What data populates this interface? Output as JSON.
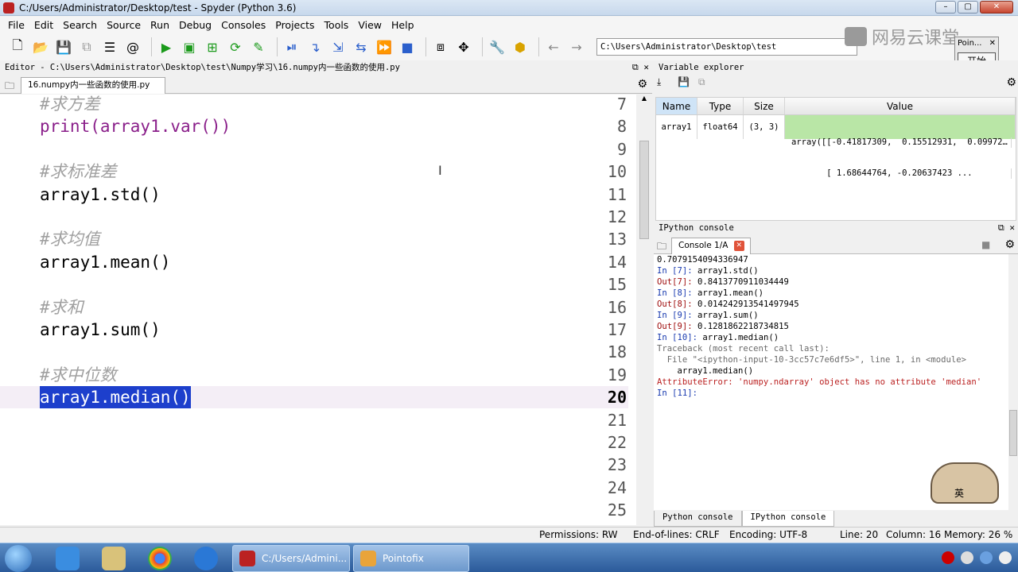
{
  "window": {
    "title": "C:/Users/Administrator/Desktop/test - Spyder (Python 3.6)",
    "controls": [
      "–",
      "▢",
      "✕"
    ]
  },
  "menu": [
    "File",
    "Edit",
    "Search",
    "Source",
    "Run",
    "Debug",
    "Consoles",
    "Projects",
    "Tools",
    "View",
    "Help"
  ],
  "toolbar": {
    "path": "C:\\Users\\Administrator\\Desktop\\test"
  },
  "watermark": "网易云课堂",
  "pointofix": {
    "title": "Poin...",
    "button": "开始"
  },
  "editor": {
    "pane_title": "Editor - C:\\Users\\Administrator\\Desktop\\test\\Numpy学习\\16.numpy内一些函数的使用.py",
    "tab": "16.numpy内一些函数的使用.py",
    "lines": [
      {
        "n": "7",
        "text": "#求方差",
        "kind": "comment"
      },
      {
        "n": "8",
        "text": "print(array1.var())",
        "kind": "print"
      },
      {
        "n": "9",
        "text": "",
        "kind": "code"
      },
      {
        "n": "10",
        "text": "#求标准差",
        "kind": "comment"
      },
      {
        "n": "11",
        "text": "array1.std()",
        "kind": "code"
      },
      {
        "n": "12",
        "text": "",
        "kind": "code"
      },
      {
        "n": "13",
        "text": "#求均值",
        "kind": "comment"
      },
      {
        "n": "14",
        "text": "array1.mean()",
        "kind": "code"
      },
      {
        "n": "15",
        "text": "",
        "kind": "code"
      },
      {
        "n": "16",
        "text": "#求和",
        "kind": "comment"
      },
      {
        "n": "17",
        "text": "array1.sum()",
        "kind": "code"
      },
      {
        "n": "18",
        "text": "",
        "kind": "code"
      },
      {
        "n": "19",
        "text": "#求中位数",
        "kind": "comment"
      },
      {
        "n": "20",
        "text": "array1.median()",
        "kind": "selected"
      },
      {
        "n": "21",
        "text": "",
        "kind": "code"
      },
      {
        "n": "22",
        "text": "",
        "kind": "code"
      },
      {
        "n": "23",
        "text": "",
        "kind": "code"
      },
      {
        "n": "24",
        "text": "",
        "kind": "code"
      },
      {
        "n": "25",
        "text": "",
        "kind": "code"
      }
    ]
  },
  "variable_explorer": {
    "title": "Variable explorer",
    "headers": {
      "name": "Name",
      "type": "Type",
      "size": "Size",
      "value": "Value"
    },
    "rows": [
      {
        "name": "array1",
        "type": "float64",
        "size": "(3, 3)",
        "value_line1": "array([[-0.41817309,  0.15512931,  0.09972…",
        "value_line2": "       [ 1.68644764, -0.20637423 ..."
      }
    ]
  },
  "ipython": {
    "title": "IPython console",
    "tab": "Console 1/A",
    "lines": [
      {
        "text": "0.7079154094336947",
        "cls": ""
      },
      {
        "text": "",
        "cls": ""
      },
      {
        "text": "In [7]: array1.std()",
        "cls": "in"
      },
      {
        "text": "Out[7]: 0.8413770911034449",
        "cls": "out"
      },
      {
        "text": "",
        "cls": ""
      },
      {
        "text": "In [8]: array1.mean()",
        "cls": "in"
      },
      {
        "text": "Out[8]: 0.014242913541497945",
        "cls": "out"
      },
      {
        "text": "",
        "cls": ""
      },
      {
        "text": "In [9]: array1.sum()",
        "cls": "in"
      },
      {
        "text": "Out[9]: 0.1281862218734815",
        "cls": "out"
      },
      {
        "text": "",
        "cls": ""
      },
      {
        "text": "In [10]: array1.median()",
        "cls": "in"
      },
      {
        "text": "Traceback (most recent call last):",
        "cls": "tb"
      },
      {
        "text": "",
        "cls": ""
      },
      {
        "text": "  File \"<ipython-input-10-3cc57c7e6df5>\", line 1, in <module>",
        "cls": "file"
      },
      {
        "text": "    array1.median()",
        "cls": ""
      },
      {
        "text": "",
        "cls": ""
      },
      {
        "text": "AttributeError: 'numpy.ndarray' object has no attribute 'median'",
        "cls": "err"
      },
      {
        "text": "",
        "cls": ""
      },
      {
        "text": "",
        "cls": ""
      },
      {
        "text": "In [11]:",
        "cls": "in"
      }
    ],
    "bottom_tabs": [
      "Python console",
      "IPython console"
    ]
  },
  "mascot_text": "英",
  "status": {
    "permissions": "Permissions: RW",
    "eol": "End-of-lines: CRLF",
    "encoding": "Encoding: UTF-8",
    "line": "Line: 20",
    "column": "Column: 16",
    "memory": "Memory: 26 %"
  },
  "taskbar": {
    "task1": "C:/Users/Admini...",
    "task2": "Pointofix"
  }
}
